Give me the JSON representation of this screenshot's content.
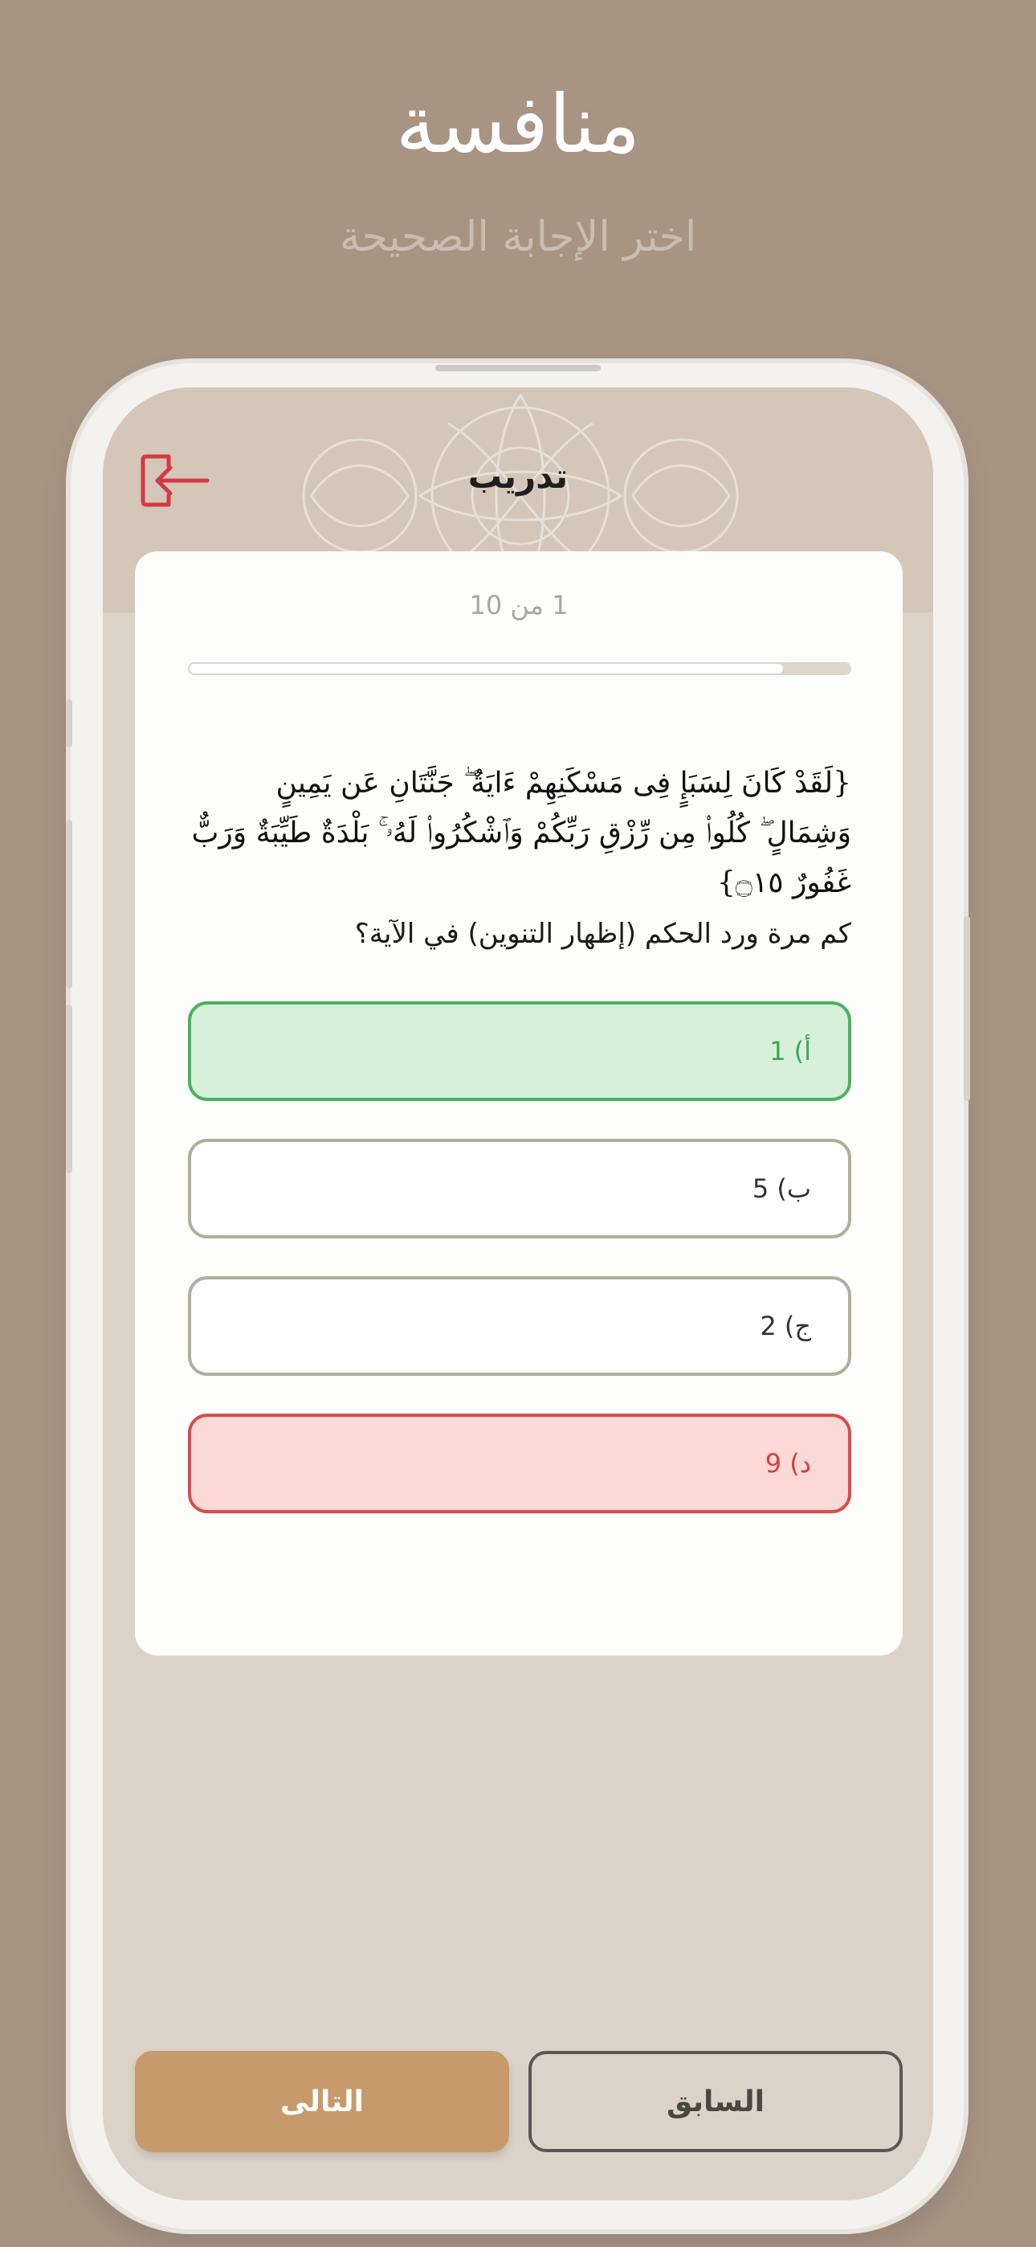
{
  "marketing": {
    "title": "منافسة",
    "subtitle": "اختر الإجابة الصحيحة"
  },
  "screen": {
    "title": "تدريب",
    "exit_icon": "exit-door-icon"
  },
  "progress": {
    "text": "1 من 10",
    "current": 1,
    "total": 10
  },
  "verse": "{لَقَدْ كَانَ لِسَبَإٍ فِى مَسْكَنِهِمْ ءَايَةٌ ۖ جَنَّتَانِ عَن يَمِينٍ وَشِمَالٍ ۖ كُلُوا۟ مِن رِّزْقِ رَبِّكُمْ وَٱشْكُرُوا۟ لَهُۥ ۚ بَلْدَةٌ طَيِّبَةٌ وَرَبٌّ غَفُورٌ ۝١٥}",
  "question": "كم مرة ورد الحكم (إظهار التنوين) في الآية؟",
  "options": [
    {
      "label": "أ) 1",
      "state": "correct"
    },
    {
      "label": "ب) 5",
      "state": "default"
    },
    {
      "label": "ج) 2",
      "state": "default"
    },
    {
      "label": "د) 9",
      "state": "wrong"
    }
  ],
  "buttons": {
    "next": "التالى",
    "prev": "السابق"
  },
  "colors": {
    "background": "#a89483",
    "accent": "#c79a6c",
    "correct": "#4cb25e",
    "wrong": "#d94c4c",
    "exit_icon": "#d23a45"
  }
}
